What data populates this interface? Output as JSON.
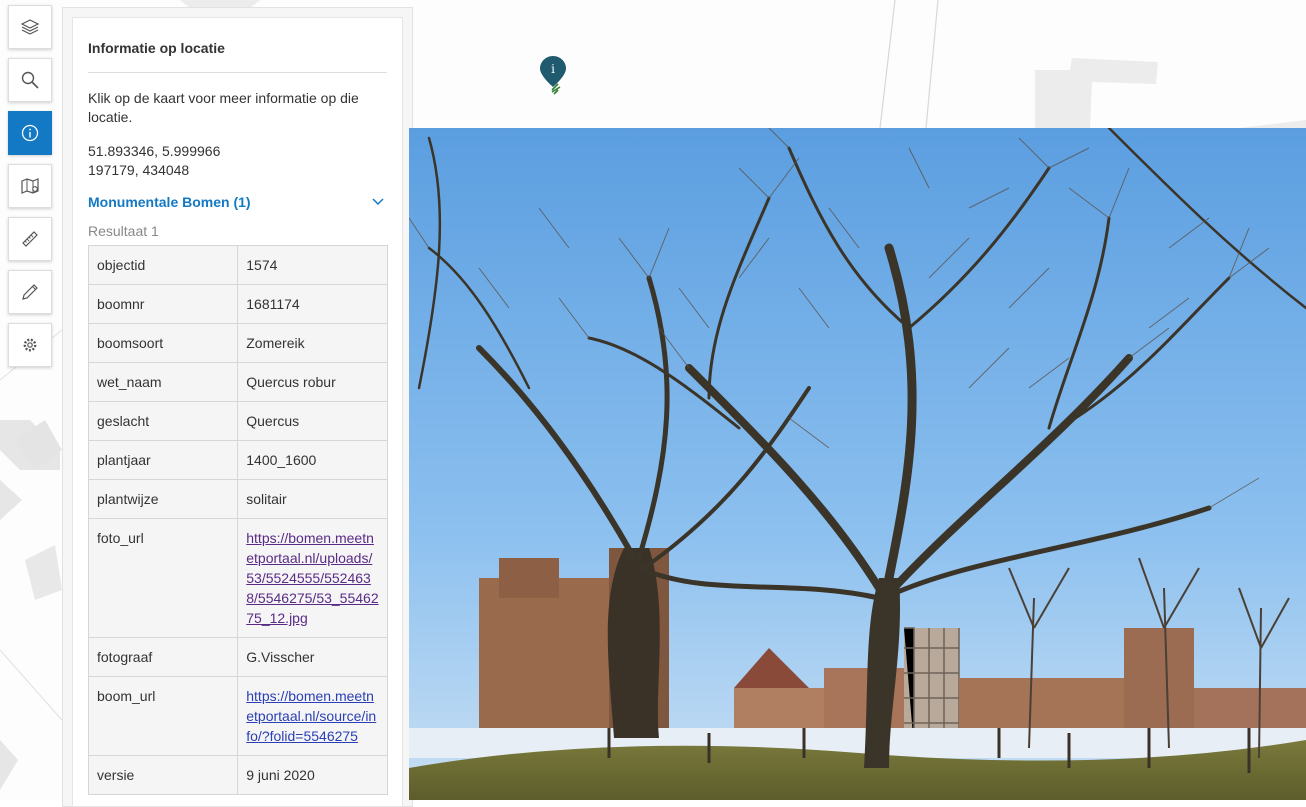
{
  "toolbar": {
    "tools": [
      {
        "name": "layers-icon",
        "active": false
      },
      {
        "name": "search-icon",
        "active": false
      },
      {
        "name": "info-icon",
        "active": true
      },
      {
        "name": "map-route-icon",
        "active": false
      },
      {
        "name": "ruler-icon",
        "active": false
      },
      {
        "name": "pencil-icon",
        "active": false
      },
      {
        "name": "settings-icon",
        "active": false
      }
    ]
  },
  "panel": {
    "title": "Informatie op locatie",
    "intro": "Klik op de kaart voor meer informatie op die locatie.",
    "coords_wgs84": "51.893346, 5.999966",
    "coords_rd": "197179, 434048",
    "layer_title": "Monumentale Bomen (1)",
    "result_label": "Resultaat 1",
    "rows": [
      {
        "key": "objectid",
        "value": "1574"
      },
      {
        "key": "boomnr",
        "value": "1681174"
      },
      {
        "key": "boomsoort",
        "value": "Zomereik"
      },
      {
        "key": "wet_naam",
        "value": "Quercus robur"
      },
      {
        "key": "geslacht",
        "value": "Quercus"
      },
      {
        "key": "plantjaar",
        "value": "1400_1600"
      },
      {
        "key": "plantwijze",
        "value": "solitair"
      },
      {
        "key": "foto_url",
        "value": "https://bomen.meetnetportaal.nl/uploads/53/5524555/5524638/5546275/53_5546275_12.jpg"
      },
      {
        "key": "fotograaf",
        "value": "G.Visscher"
      },
      {
        "key": "boom_url",
        "value": "https://bomen.meetnetportaal.nl/source/info/?folid=5546275"
      },
      {
        "key": "versie",
        "value": "9 juni 2020"
      }
    ]
  },
  "colors": {
    "accent": "#1479c4",
    "link_visited": "#5a2b86",
    "link": "#2a3fb5",
    "marker": "#1f5a6e"
  }
}
